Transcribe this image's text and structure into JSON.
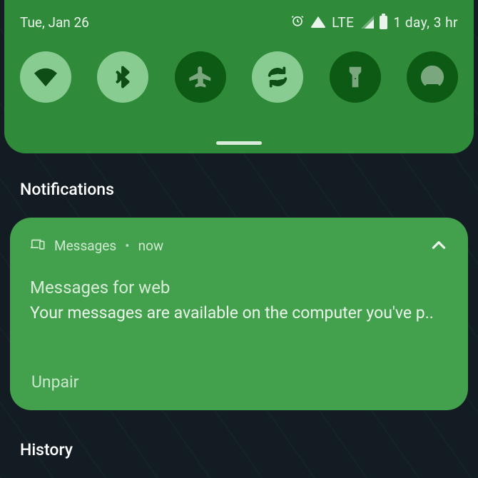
{
  "status": {
    "date": "Tue, Jan 26",
    "network_label": "LTE",
    "battery_text": "1 day, 3 hr"
  },
  "qs_tiles": [
    {
      "id": "wifi",
      "name": "wifi",
      "on": true
    },
    {
      "id": "bt",
      "name": "bluetooth",
      "on": true
    },
    {
      "id": "air",
      "name": "airplane-mode",
      "on": false
    },
    {
      "id": "sync",
      "name": "auto-rotate",
      "on": true
    },
    {
      "id": "flash",
      "name": "flashlight",
      "on": false
    },
    {
      "id": "cast",
      "name": "hotspot",
      "on": false
    }
  ],
  "sections": {
    "notifications": "Notifications",
    "history": "History"
  },
  "notification": {
    "app_name": "Messages",
    "time_sep": "•",
    "time": "now",
    "title": "Messages for web",
    "body": "Your messages are available on the computer you've p..",
    "action": "Unpair"
  },
  "colors": {
    "panel": "#2f8b3a",
    "card": "#43a14d",
    "tile_on": "#88cc91",
    "tile_off": "#0c5a14"
  }
}
